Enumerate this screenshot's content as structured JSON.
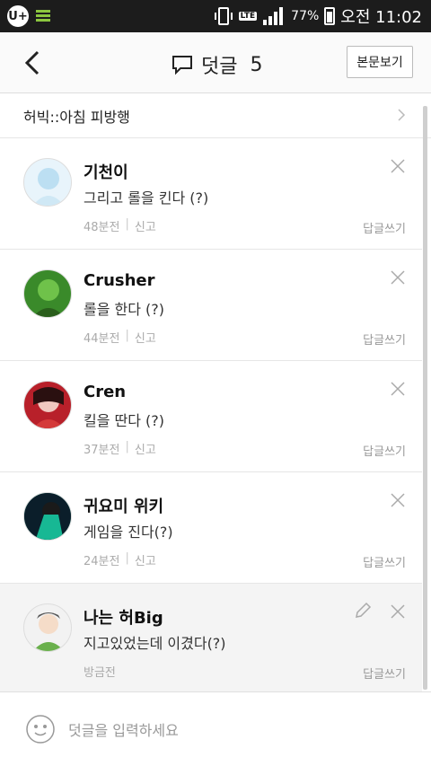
{
  "status_bar": {
    "battery": "77%",
    "time": "오전 11:02",
    "network": "LTE",
    "carrier_icon": "U+"
  },
  "header": {
    "title": "덧글",
    "count": "5",
    "view_post_label": "본문보기"
  },
  "post": {
    "title": "허빅::아침 피방행"
  },
  "comments": [
    {
      "name": "기천이",
      "text": "그리고 롤을 킨다 (?)",
      "time": "48분전",
      "report": "신고",
      "reply": "답글쓰기",
      "avatar_color": "#e8f4fb"
    },
    {
      "name": "Crusher",
      "text": "롤을 한다 (?)",
      "time": "44분전",
      "report": "신고",
      "reply": "답글쓰기",
      "avatar_color": "#3a8a2a"
    },
    {
      "name": "Cren",
      "text": "킬을 딴다 (?)",
      "time": "37분전",
      "report": "신고",
      "reply": "답글쓰기",
      "avatar_color": "#b8202a"
    },
    {
      "name": "귀요미 위키",
      "text": "게임을 진다(?)",
      "time": "24분전",
      "report": "신고",
      "reply": "답글쓰기",
      "avatar_color": "#0f8f7a"
    },
    {
      "name": "나는 허Big",
      "text": "지고있었는데 이겼다(?)",
      "time": "방금전",
      "report": "",
      "reply": "답글쓰기",
      "avatar_color": "#6ab04c"
    }
  ],
  "input": {
    "placeholder": "덧글을 입력하세요"
  }
}
